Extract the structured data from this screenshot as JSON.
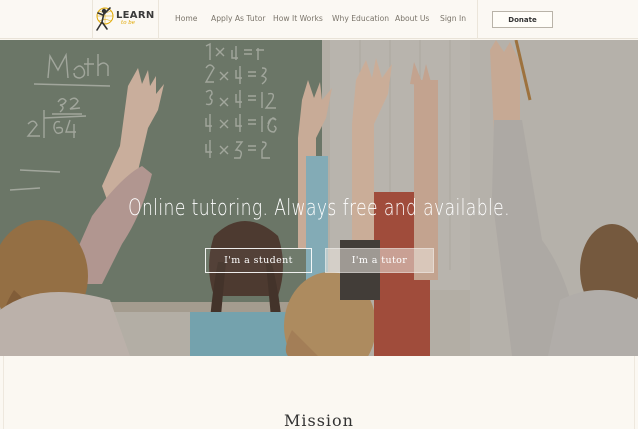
{
  "header": {
    "logo": {
      "name": "LEARN",
      "tagline": "to be",
      "icon": "reaching-figure-globe-icon"
    },
    "nav": [
      {
        "label": "Home"
      },
      {
        "label": "Apply As Tutor"
      },
      {
        "label": "How It Works"
      },
      {
        "label": "Why Education"
      },
      {
        "label": "About Us"
      },
      {
        "label": "Sign In"
      }
    ],
    "donate_label": "Donate"
  },
  "hero": {
    "headline": "Online tutoring. Always free and available.",
    "buttons": [
      {
        "label": "I'm a student"
      },
      {
        "label": "I'm a tutor"
      }
    ],
    "background": {
      "chalkboard": [
        "Math",
        "32",
        "2|64",
        "1×4=4",
        "2×4=8",
        "3×4=12",
        "4×4=16",
        "4×5=20"
      ]
    }
  },
  "mission": {
    "title": "Mission"
  },
  "colors": {
    "page_bg": "#faf6ef",
    "accent_gold": "#e0a800",
    "text_dark": "#333333"
  }
}
